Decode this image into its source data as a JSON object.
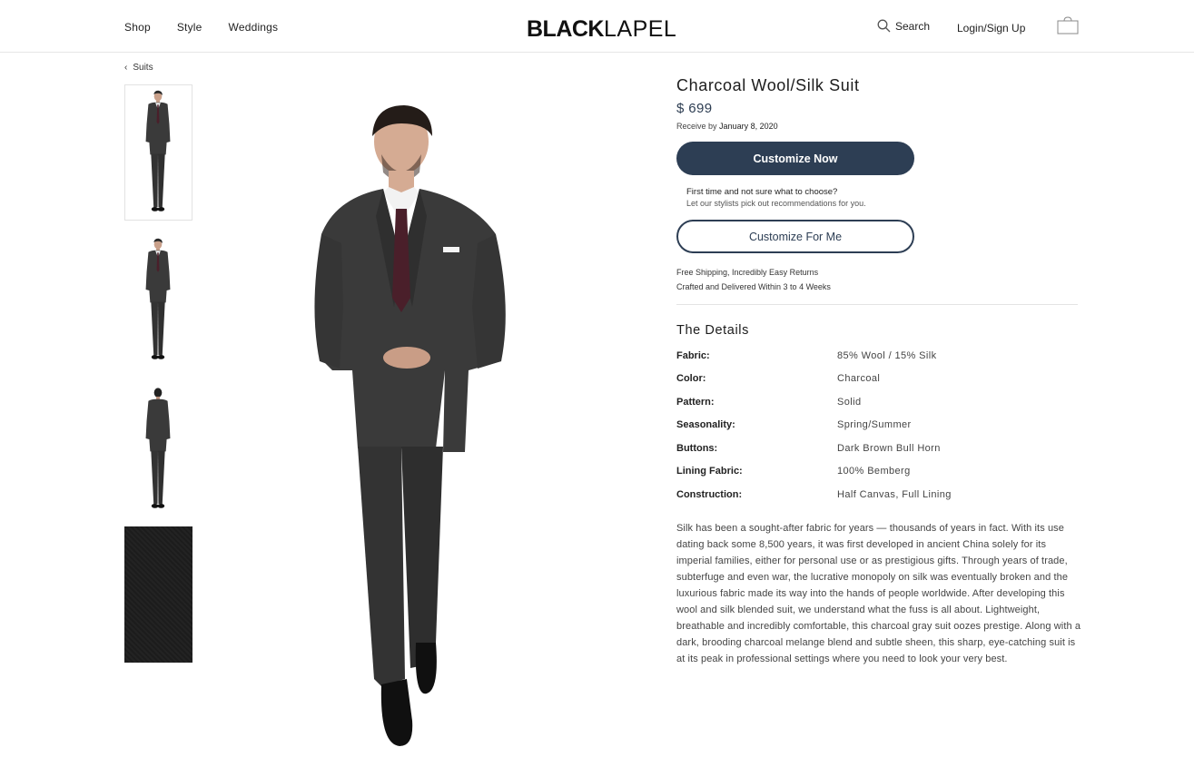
{
  "header": {
    "nav": [
      "Shop",
      "Style",
      "Weddings"
    ],
    "logo_bold": "BLACK",
    "logo_light": "LAPEL",
    "search_label": "Search",
    "login_label": "Login/Sign Up"
  },
  "breadcrumb": {
    "label": "Suits"
  },
  "product": {
    "title": "Charcoal Wool/Silk Suit",
    "price": "$ 699",
    "receive_prefix": "Receive by",
    "receive_date": "January 8, 2020",
    "customize_now": "Customize Now",
    "first_time": "First time and not sure what to choose?",
    "stylists": "Let our stylists pick out recommendations for you.",
    "customize_for_me": "Customize For Me",
    "shipping": "Free Shipping, Incredibly Easy Returns",
    "crafted": "Crafted and Delivered Within 3 to 4 Weeks"
  },
  "details": {
    "heading": "The Details",
    "rows": [
      {
        "k": "Fabric:",
        "v": "85% Wool / 15% Silk"
      },
      {
        "k": "Color:",
        "v": "Charcoal"
      },
      {
        "k": "Pattern:",
        "v": "Solid"
      },
      {
        "k": "Seasonality:",
        "v": "Spring/Summer"
      },
      {
        "k": "Buttons:",
        "v": "Dark Brown Bull Horn"
      },
      {
        "k": "Lining Fabric:",
        "v": "100% Bemberg"
      },
      {
        "k": "Construction:",
        "v": "Half Canvas, Full Lining"
      }
    ],
    "description": "Silk has been a sought-after fabric for years — thousands of years in fact. With its use dating back some 8,500 years, it was first developed in ancient China solely for its imperial families, either for personal use or as prestigious gifts. Through years of trade, subterfuge and even war, the lucrative monopoly on silk was eventually broken and the luxurious fabric made its way into the hands of people worldwide. After developing this wool and silk blended suit, we understand what the fuss is all about. Lightweight, breathable and incredibly comfortable, this charcoal gray suit oozes prestige. Along with a dark, brooding charcoal melange blend and subtle sheen, this sharp, eye-catching suit is at its peak in professional settings where you need to look your very best."
  },
  "colors": {
    "brand_navy": "#2d3e54",
    "suit_charcoal": "#3a3a3a",
    "tie_burgundy": "#4a1f2a"
  }
}
